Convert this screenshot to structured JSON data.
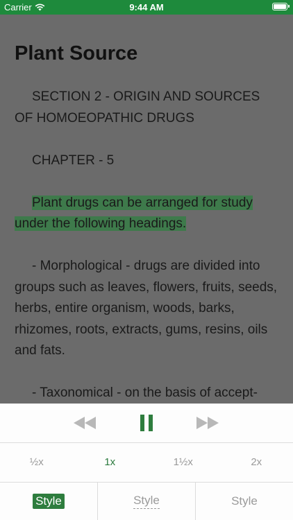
{
  "status_bar": {
    "carrier": "Carrier",
    "time": "9:44 AM"
  },
  "reader": {
    "title": "Plant Source",
    "paragraphs": {
      "p1": "SECTION 2 - ORIGIN AND SOURCES OF HOMOEOPATHIC DRUGS",
      "p2": "CHAPTER - 5",
      "p3": "Plant drugs can be arranged for study under the following headings.",
      "p4": "- Morphological - drugs are divided into groups such as leaves, flowers, fruits, seeds, herbs, entire organism, woods, barks, rhizomes, roots, extracts, gums, resins, oils and fats.",
      "p5": "- Taxonomical - on the basis of accept-"
    }
  },
  "player": {
    "speeds": [
      "½x",
      "1x",
      "1½x",
      "2x"
    ],
    "styles": [
      "Style",
      "Style",
      "Style"
    ]
  },
  "colors": {
    "accent": "#2e7d3e",
    "status_bar": "#1e8a3c",
    "highlight": "#3e7a4b",
    "overlay": "#6b6b6b"
  }
}
